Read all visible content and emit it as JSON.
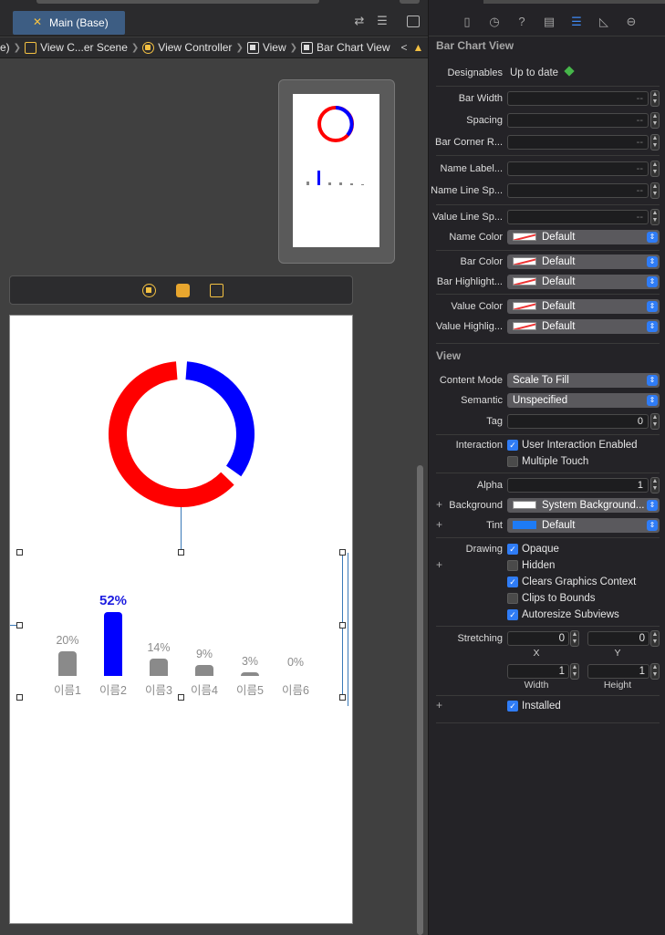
{
  "editor": {
    "tab_title": "Main (Base)",
    "breadcrumbs": [
      "e)",
      "View C...er Scene",
      "View Controller",
      "View",
      "Bar Chart View"
    ],
    "nav_back": "<",
    "nav_warning": "▲"
  },
  "chart": {
    "donut": [
      {
        "label": "blue",
        "fraction": 0.36,
        "color": "#0000ff"
      },
      {
        "label": "red",
        "fraction": 0.64,
        "color": "#ff0000"
      }
    ],
    "bars": [
      {
        "name": "이름1",
        "value_label": "20%",
        "value": 20,
        "highlight": false
      },
      {
        "name": "이름2",
        "value_label": "52%",
        "value": 52,
        "highlight": true
      },
      {
        "name": "이름3",
        "value_label": "14%",
        "value": 14,
        "highlight": false
      },
      {
        "name": "이름4",
        "value_label": "9%",
        "value": 9,
        "highlight": false
      },
      {
        "name": "이름5",
        "value_label": "3%",
        "value": 3,
        "highlight": false
      },
      {
        "name": "이름6",
        "value_label": "0%",
        "value": 0,
        "highlight": false
      }
    ],
    "bar_color": "#8a8a8a",
    "highlight_color": "#0000ff"
  },
  "inspector": {
    "tabs": [
      "file-icon",
      "history-icon",
      "help-icon",
      "identity-icon",
      "attributes-icon",
      "size-icon",
      "connections-icon"
    ],
    "bar_chart_section": {
      "title": "Bar Chart View",
      "designables_label": "Designables",
      "designables_value": "Up to date",
      "bar_width_label": "Bar Width",
      "spacing_label": "Spacing",
      "corner_label": "Bar Corner R...",
      "name_label_label": "Name Label...",
      "name_line_label": "Name Line Sp...",
      "value_line_label": "Value Line Sp...",
      "name_color_label": "Name Color",
      "bar_color_label": "Bar Color",
      "bar_highlight_label": "Bar Highlight...",
      "value_color_label": "Value Color",
      "value_highlight_label": "Value Highlig...",
      "empty_placeholder": "--",
      "default_value": "Default"
    },
    "view_section": {
      "title": "View",
      "content_mode_label": "Content Mode",
      "content_mode_value": "Scale To Fill",
      "semantic_label": "Semantic",
      "semantic_value": "Unspecified",
      "tag_label": "Tag",
      "tag_value": "0",
      "interaction_label": "Interaction",
      "user_interaction": "User Interaction Enabled",
      "multiple_touch": "Multiple Touch",
      "alpha_label": "Alpha",
      "alpha_value": "1",
      "background_label": "Background",
      "background_value": "System Background...",
      "tint_label": "Tint",
      "tint_value": "Default",
      "drawing_label": "Drawing",
      "opaque": "Opaque",
      "hidden": "Hidden",
      "clears_context": "Clears Graphics Context",
      "clips_bounds": "Clips to Bounds",
      "autoresize": "Autoresize Subviews",
      "stretching_label": "Stretching",
      "x_value": "0",
      "y_value": "0",
      "x_label": "X",
      "y_label": "Y",
      "width_value": "1",
      "height_value": "1",
      "width_label": "Width",
      "height_label": "Height",
      "installed": "Installed"
    }
  }
}
